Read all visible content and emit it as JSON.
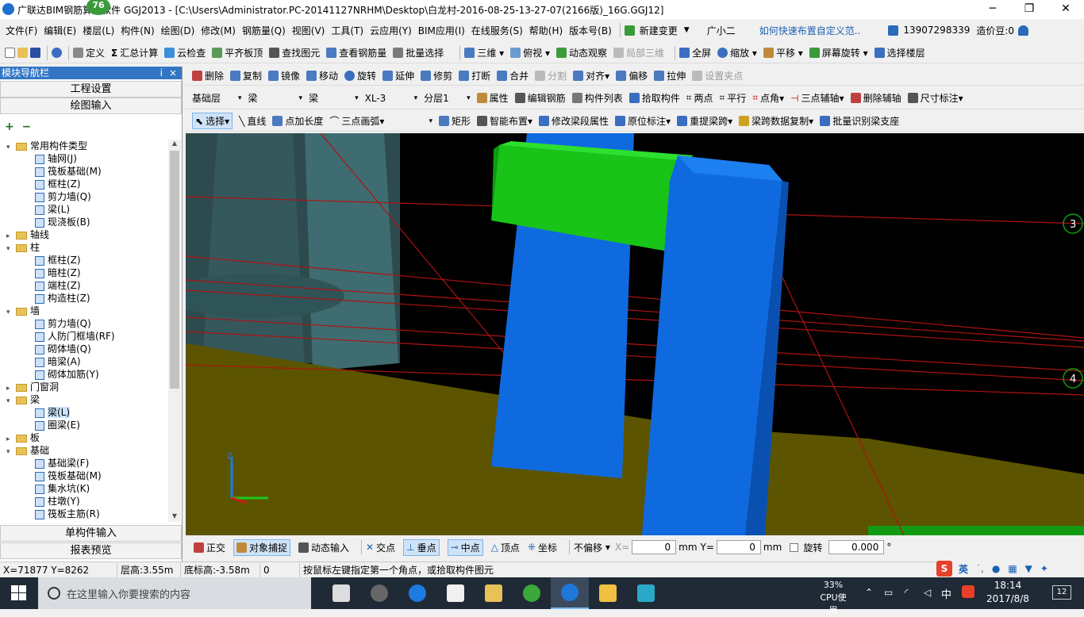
{
  "titlebar": {
    "title": "广联达BIM钢筋算量软件 GGJ2013 - [C:\\Users\\Administrator.PC-20141127NRHM\\Desktop\\白龙村-2016-08-25-13-27-07(2166版)_16G.GGJ12]",
    "badge": "76",
    "min": "─",
    "restore": "❐",
    "close": "✕"
  },
  "menubar": {
    "items": [
      "文件(F)",
      "编辑(E)",
      "楼层(L)",
      "构件(N)",
      "绘图(D)",
      "修改(M)",
      "钢筋量(Q)",
      "视图(V)",
      "工具(T)",
      "云应用(Y)",
      "BIM应用(I)",
      "在线服务(S)",
      "帮助(H)",
      "版本号(B)"
    ],
    "new_change": "新建变更",
    "guangxiao": "广小二",
    "tip": "如何快速布置自定义范..",
    "phone": "13907298339",
    "cost": "造价豆:0"
  },
  "toolbar1": {
    "items": [
      "定义",
      "汇总计算",
      "云检查",
      "平齐板顶",
      "查找图元",
      "查看钢筋量",
      "批量选择"
    ],
    "view_items": [
      "三维",
      "俯视",
      "动态观察",
      "局部三维",
      "全屏",
      "缩放",
      "平移",
      "屏幕旋转",
      "选择楼层"
    ]
  },
  "toolbar2": {
    "items": [
      "删除",
      "复制",
      "镜像",
      "移动",
      "旋转",
      "延伸",
      "修剪",
      "打断",
      "合并",
      "分割",
      "对齐",
      "偏移",
      "拉伸",
      "设置夹点"
    ]
  },
  "toolbar3": {
    "floor": "基础层",
    "type": "梁",
    "subtype": "梁",
    "component": "XL-3",
    "layer": "分层1",
    "items": [
      "属性",
      "编辑钢筋",
      "构件列表",
      "拾取构件",
      "两点",
      "平行",
      "点角",
      "三点辅轴",
      "删除辅轴",
      "尺寸标注"
    ]
  },
  "toolbar4": {
    "items": [
      "选择",
      "直线",
      "点加长度",
      "三点画弧",
      "矩形",
      "智能布置",
      "修改梁段属性",
      "原位标注",
      "重提梁跨",
      "梁跨数据复制",
      "批量识别梁支座"
    ]
  },
  "leftpanel": {
    "title": "模块导航栏",
    "pin": "ⅰ",
    "close": "×",
    "btn_project": "工程设置",
    "btn_draw": "绘图输入",
    "btn_single": "单构件输入",
    "btn_report": "报表预览",
    "tree": [
      {
        "label": "常用构件类型",
        "level": 0,
        "folder": true,
        "expanded": true
      },
      {
        "label": "轴网(J)",
        "level": 1
      },
      {
        "label": "筏板基础(M)",
        "level": 1
      },
      {
        "label": "框柱(Z)",
        "level": 1
      },
      {
        "label": "剪力墙(Q)",
        "level": 1
      },
      {
        "label": "梁(L)",
        "level": 1
      },
      {
        "label": "现浇板(B)",
        "level": 1
      },
      {
        "label": "轴线",
        "level": 0,
        "folder": true,
        "expanded": false
      },
      {
        "label": "柱",
        "level": 0,
        "folder": true,
        "expanded": true
      },
      {
        "label": "框柱(Z)",
        "level": 1
      },
      {
        "label": "暗柱(Z)",
        "level": 1
      },
      {
        "label": "端柱(Z)",
        "level": 1
      },
      {
        "label": "构造柱(Z)",
        "level": 1
      },
      {
        "label": "墙",
        "level": 0,
        "folder": true,
        "expanded": true
      },
      {
        "label": "剪力墙(Q)",
        "level": 1
      },
      {
        "label": "人防门框墙(RF)",
        "level": 1
      },
      {
        "label": "砌体墙(Q)",
        "level": 1
      },
      {
        "label": "暗梁(A)",
        "level": 1
      },
      {
        "label": "砌体加筋(Y)",
        "level": 1
      },
      {
        "label": "门窗洞",
        "level": 0,
        "folder": true,
        "expanded": false
      },
      {
        "label": "梁",
        "level": 0,
        "folder": true,
        "expanded": true
      },
      {
        "label": "梁(L)",
        "level": 1,
        "selected": true
      },
      {
        "label": "圈梁(E)",
        "level": 1
      },
      {
        "label": "板",
        "level": 0,
        "folder": true,
        "expanded": false
      },
      {
        "label": "基础",
        "level": 0,
        "folder": true,
        "expanded": true
      },
      {
        "label": "基础梁(F)",
        "level": 1
      },
      {
        "label": "筏板基础(M)",
        "level": 1
      },
      {
        "label": "集水坑(K)",
        "level": 1
      },
      {
        "label": "柱墩(Y)",
        "level": 1
      },
      {
        "label": "筏板主筋(R)",
        "level": 1
      }
    ]
  },
  "viewport": {
    "axis_labels": [
      "3",
      "4"
    ],
    "axis_z": "Z"
  },
  "snapbar": {
    "items": [
      "正交",
      "对象捕捉",
      "动态输入",
      "交点",
      "垂点",
      "中点",
      "顶点",
      "坐标"
    ],
    "offset_mode": "不偏移",
    "x_label": "X=",
    "x_value": "0",
    "y_label": "Y=",
    "y_value": "0",
    "unit": "mm",
    "rotate_label": "旋转",
    "rotate_value": "0.000",
    "degree": "°"
  },
  "statusbar": {
    "coords": "X=71877 Y=8262",
    "floor_height": "层高:3.55m",
    "bottom_elev": "底标高:-3.58m",
    "count": "0",
    "hint": "按鼠标左键指定第一个角点，或拾取构件图元"
  },
  "ime": {
    "lang": "英"
  },
  "taskbar": {
    "search_placeholder": "在这里输入你要搜索的内容",
    "cpu_percent": "33%",
    "cpu_label": "CPU使用",
    "ime": "中",
    "time": "18:14",
    "date": "2017/8/8",
    "notif": "12"
  },
  "colors": {
    "beam_green": "#17c417",
    "column_blue": "#0f6ae0",
    "slab_olive": "#5c5400",
    "wall_teal": "#2d5356",
    "axis_red": "#b01212"
  }
}
